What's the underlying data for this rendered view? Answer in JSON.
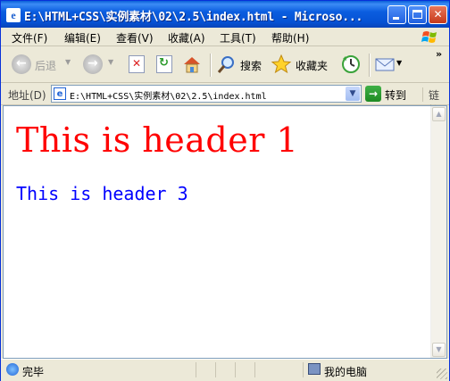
{
  "window": {
    "title": "E:\\HTML+CSS\\实例素材\\02\\2.5\\index.html - Microso..."
  },
  "menu": {
    "items": [
      "文件(F)",
      "编辑(E)",
      "查看(V)",
      "收藏(A)",
      "工具(T)",
      "帮助(H)"
    ]
  },
  "toolbar": {
    "back_label": "后退",
    "search_label": "搜索",
    "favorites_label": "收藏夹"
  },
  "address": {
    "label": "地址(D)",
    "value": "E:\\HTML+CSS\\实例素材\\02\\2.5\\index.html",
    "go_label": "转到",
    "links_label": "链接"
  },
  "content": {
    "h1": "This is header 1",
    "h3": "This is header 3",
    "h1_color": "#ff0000",
    "h3_color": "#0000ff"
  },
  "status": {
    "text": "完毕",
    "zone": "我的电脑"
  },
  "colors": {
    "titlebar": "#0a5fd8",
    "chrome": "#ece9d8"
  }
}
